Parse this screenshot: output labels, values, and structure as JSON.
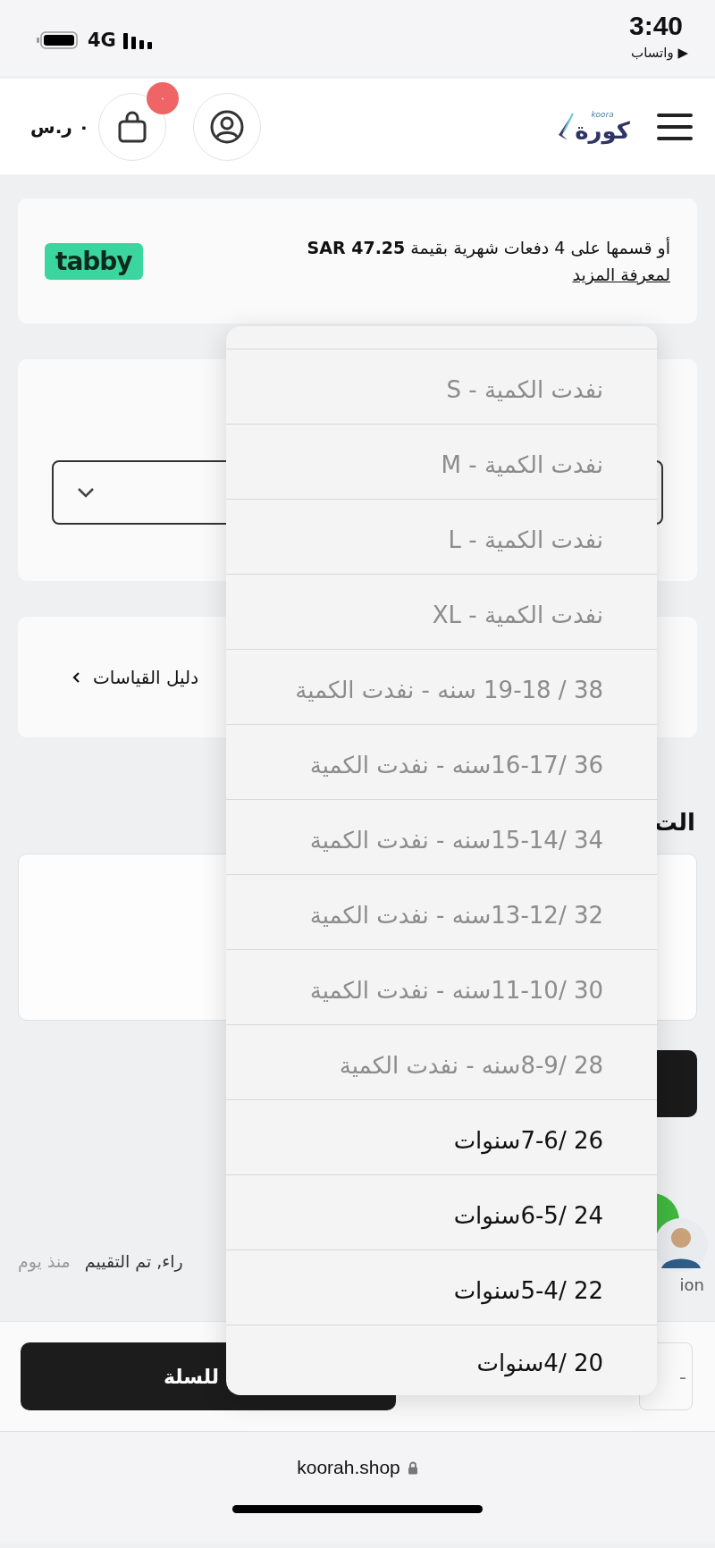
{
  "status_bar": {
    "time": "3:40",
    "back_link": "▶ واتساب",
    "network": "4G"
  },
  "header": {
    "logo_text": "كورة",
    "logo_subtext": "koora",
    "cart_count": "٠",
    "cart_total": "٠ ر.س"
  },
  "tabby": {
    "text": "أو قسمها على 4 دفعات شهرية بقيمة **SAR 47.25**",
    "link": "لمعرفة المزيد",
    "badge": "tabby"
  },
  "size_guide": {
    "label": "دليل القياسات"
  },
  "section_title": "الت",
  "review": {
    "text": "راء, تم التقييم",
    "time": "منذ يوم",
    "reviewer": "ion"
  },
  "bottom_bar": {
    "add_to_cart": "للسلة",
    "quantity_minus": "-"
  },
  "browser": {
    "url": "koorah.shop"
  },
  "dropdown": {
    "options": [
      {
        "label": "نفدت الكمية - S",
        "disabled": true
      },
      {
        "label": "نفدت الكمية - M",
        "disabled": true
      },
      {
        "label": "نفدت الكمية - L",
        "disabled": true
      },
      {
        "label": "نفدت الكمية - XL",
        "disabled": true
      },
      {
        "label": "38 / 19-18 سنه - نفدت الكمية",
        "disabled": true
      },
      {
        "label": "36 /16-17سنه - نفدت الكمية",
        "disabled": true
      },
      {
        "label": "34 /15-14سنه - نفدت الكمية",
        "disabled": true
      },
      {
        "label": "32 /13-12سنه - نفدت الكمية",
        "disabled": true
      },
      {
        "label": "30 /11-10سنه - نفدت الكمية",
        "disabled": true
      },
      {
        "label": "28 /8-9سنه - نفدت الكمية",
        "disabled": true
      },
      {
        "label": "26 /7-6سنوات",
        "disabled": false
      },
      {
        "label": "24 /6-5سنوات",
        "disabled": false
      },
      {
        "label": "22 /5-4سنوات",
        "disabled": false
      },
      {
        "label": "20 /4سنوات",
        "disabled": false
      }
    ]
  }
}
